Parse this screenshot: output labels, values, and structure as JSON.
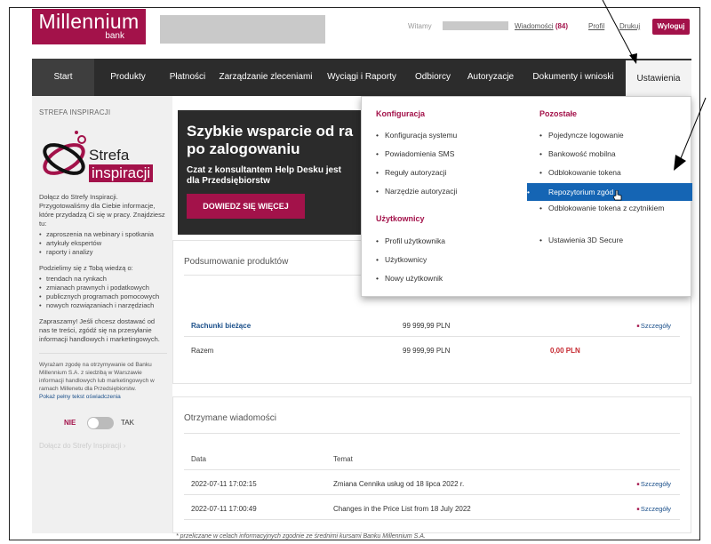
{
  "header": {
    "logo_main": "Millennium",
    "logo_sub": "bank",
    "welcome": "Witamy",
    "messages_label": "Wiadomości",
    "messages_count": "(84)",
    "profile": "Profil",
    "print": "Drukuj",
    "logout": "Wyloguj"
  },
  "nav": {
    "items": [
      {
        "label": "Start"
      },
      {
        "label": "Produkty"
      },
      {
        "label": "Płatności"
      },
      {
        "label": "Zarządzanie zleceniami"
      },
      {
        "label": "Wyciągi i Raporty"
      },
      {
        "label": "Odbiorcy"
      },
      {
        "label": "Autoryzacje"
      },
      {
        "label": "Dokumenty i wnioski"
      },
      {
        "label": "Ustawienia"
      }
    ]
  },
  "sidebar": {
    "title": "STREFA INSPIRACJI",
    "logo_word1": "Strefa",
    "logo_word2": "inspiracji",
    "intro": "Dołącz do Strefy Inspiracji. Przygotowaliśmy dla Ciebie informacje, które przydadzą Ci się w pracy. Znajdziesz tu:",
    "list1": [
      "zaproszenia na webinary i spotkania",
      "artykuły ekspertów",
      "raporty i analizy"
    ],
    "share_text": "Podzielimy się z Tobą wiedzą o:",
    "list2": [
      "trendach na rynkach",
      "zmianach prawnych i podatkowych",
      "publicznych programach pomocowych",
      "nowych rozwiązaniach i narzędziach"
    ],
    "invite": "Zapraszamy! Jeśli chcesz dostawać od nas te treści, zgódź się na przesyłanie informacji handlowych i marketingowych.",
    "consent": "Wyrażam zgodę na otrzymywanie od Banku Millennium S.A. z siedzibą w Warszawie informacji handlowych lub marketingowych w ramach Millenetu dla Przedsiębiorstw.",
    "consent_link": "Pokaż pełny tekst oświadczenia",
    "toggle_no": "NIE",
    "toggle_yes": "TAK",
    "join_link": "Dołącz do Strefy Inspiracji"
  },
  "hero": {
    "title_line1": "Szybkie wsparcie od ra",
    "title_line2": "po zalogowaniu",
    "sub_line1": "Czat z konsultantem Help Desku jest",
    "sub_line2": "dla Przedsiębiorstw",
    "button": "DOWIEDZ SIĘ WIĘCEJ"
  },
  "summary": {
    "title": "Podsumowanie produktów",
    "rows": [
      {
        "name": "Rachunki bieżące",
        "amount": "99 999,99 PLN",
        "link": "Szczegóły"
      },
      {
        "name": "Razem",
        "amount": "99 999,99 PLN",
        "extra": "0,00 PLN"
      }
    ]
  },
  "messages": {
    "title": "Otrzymane wiadomości",
    "col_date": "Data",
    "col_subject": "Temat",
    "rows": [
      {
        "date": "2022-07-11 17:02:15",
        "subject": "Zmiana Cennika usług od 18 lipca 2022 r.",
        "link": "Szczegóły"
      },
      {
        "date": "2022-07-11 17:00:49",
        "subject": "Changes in the Price List from 18 July 2022",
        "link": "Szczegóły"
      }
    ]
  },
  "footnote": "* przeliczane w celach informacyjnych zgodnie ze średnimi kursami Banku Millennium S.A.",
  "dropdown": {
    "konfiguracja_title": "Konfiguracja",
    "konfiguracja": [
      "Konfiguracja systemu",
      "Powiadomienia SMS",
      "Reguły autoryzacji",
      "Narzędzie autoryzacji"
    ],
    "uzytkownicy_title": "Użytkownicy",
    "uzytkownicy": [
      "Profil użytkownika",
      "Użytkownicy",
      "Nowy użytkownik"
    ],
    "pozostale_title": "Pozostałe",
    "pozostale": [
      "Pojedyncze logowanie",
      "Bankowość mobilna",
      "Odblokowanie tokena",
      "Repozytorium zgód",
      "Odblokowanie tokena z czytnikiem",
      "Ustawienia 3D Secure"
    ]
  },
  "colors": {
    "brand": "#a3124a",
    "nav_bg": "#2c2c2c",
    "highlight": "#1565b4",
    "link": "#1a4f8a"
  }
}
